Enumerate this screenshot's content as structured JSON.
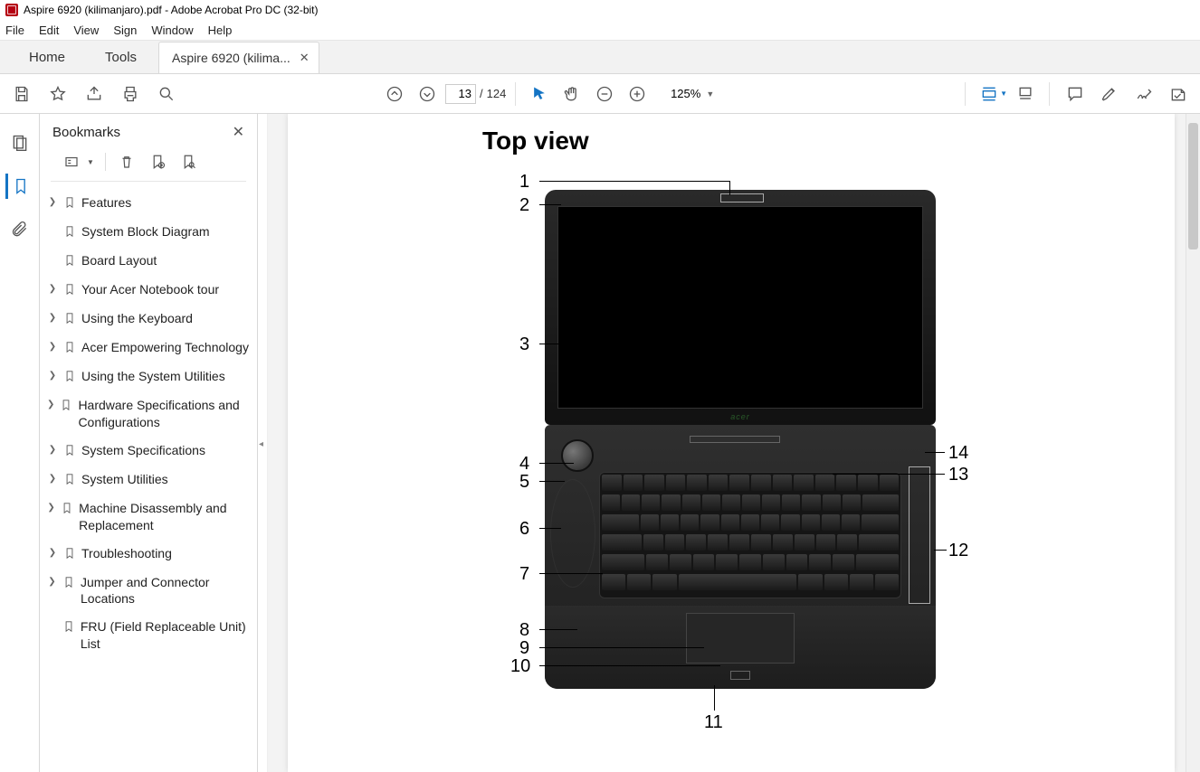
{
  "window": {
    "title": "Aspire 6920 (kilimanjaro).pdf - Adobe Acrobat Pro DC (32-bit)"
  },
  "menu": {
    "file": "File",
    "edit": "Edit",
    "view": "View",
    "sign": "Sign",
    "window": "Window",
    "help": "Help"
  },
  "tabs": {
    "home": "Home",
    "tools": "Tools",
    "doc": "Aspire 6920 (kilima..."
  },
  "toolbar": {
    "page_current": "13",
    "page_sep": "/",
    "page_total": "124",
    "zoom": "125%"
  },
  "panel": {
    "title": "Bookmarks"
  },
  "bookmarks": [
    {
      "label": "Features",
      "expandable": true
    },
    {
      "label": "System Block Diagram",
      "expandable": false
    },
    {
      "label": "Board Layout",
      "expandable": false
    },
    {
      "label": "Your Acer Notebook tour",
      "expandable": true
    },
    {
      "label": "Using the Keyboard",
      "expandable": true
    },
    {
      "label": "Acer Empowering Technology",
      "expandable": true
    },
    {
      "label": "Using the System Utilities",
      "expandable": true
    },
    {
      "label": "Hardware Specifications and Configurations",
      "expandable": true
    },
    {
      "label": "System Specifications",
      "expandable": true
    },
    {
      "label": "System Utilities",
      "expandable": true
    },
    {
      "label": "Machine Disassembly and Replacement",
      "expandable": true
    },
    {
      "label": "Troubleshooting",
      "expandable": true
    },
    {
      "label": "Jumper and Connector Locations",
      "expandable": true
    },
    {
      "label": "FRU (Field Replaceable Unit) List",
      "expandable": false
    }
  ],
  "doc": {
    "heading": "Top view",
    "brand": "acer",
    "callouts": {
      "n1": "1",
      "n2": "2",
      "n3": "3",
      "n4": "4",
      "n5": "5",
      "n6": "6",
      "n7": "7",
      "n8": "8",
      "n9": "9",
      "n10": "10",
      "n11": "11",
      "n12": "12",
      "n13": "13",
      "n14": "14"
    }
  }
}
